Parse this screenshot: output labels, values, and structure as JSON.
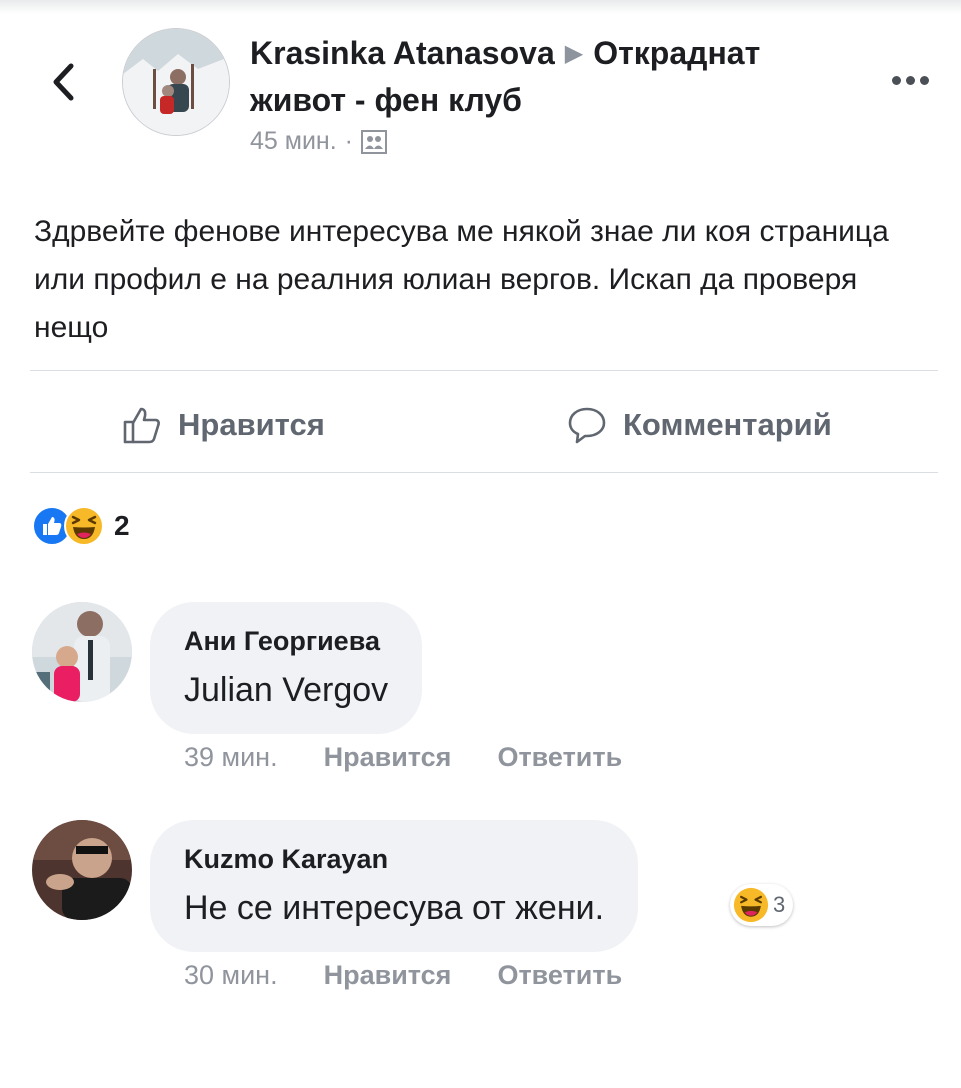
{
  "post": {
    "author": "Krasinka Atanasova",
    "group": "Откраднат живот - фен клуб",
    "time": "45 мин.",
    "meta_separator": "·",
    "text": "Здрвейте фенове интересува ме някой знае ли коя страница или профил е на реалния юлиан вергов. Искап да проверя нещо"
  },
  "actions": {
    "like_label": "Нравится",
    "comment_label": "Комментарий"
  },
  "reactions": {
    "count": "2",
    "types": [
      "like",
      "haha"
    ]
  },
  "comments": [
    {
      "author": "Ани Георгиева",
      "text": "Julian Vergov",
      "time": "39 мин.",
      "like_label": "Нравится",
      "reply_label": "Ответить"
    },
    {
      "author": "Kuzmo Karayan",
      "text": "Не се интересува от жени.",
      "time": "30 мин.",
      "like_label": "Нравится",
      "reply_label": "Ответить",
      "reaction_count": "3",
      "reaction_type": "haha"
    }
  ],
  "colors": {
    "like_blue": "#1877f2",
    "haha_yellow": "#f7b928",
    "bubble_bg": "#f0f2f5",
    "meta_gray": "#90949c"
  }
}
